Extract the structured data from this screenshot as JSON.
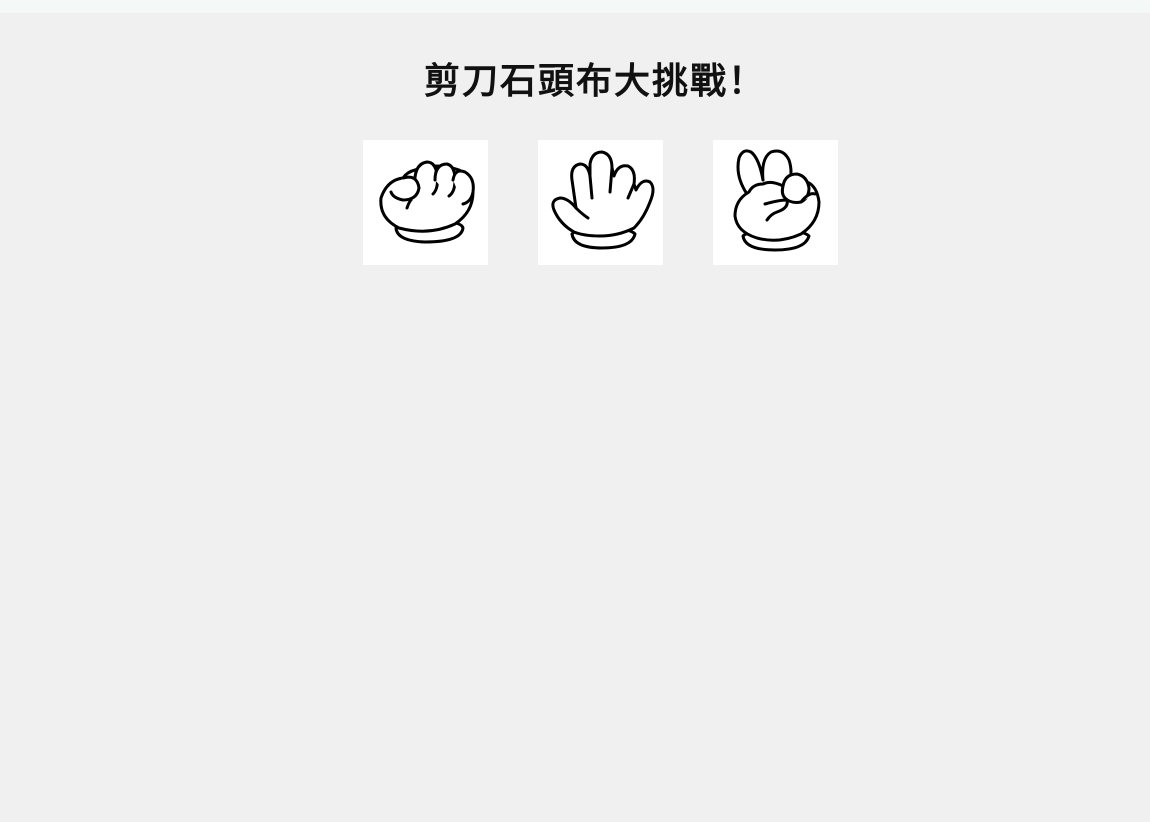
{
  "header": {
    "title": "剪刀石頭布大挑戰！"
  },
  "choices": [
    {
      "name": "rock",
      "icon": "rock-hand-icon"
    },
    {
      "name": "paper",
      "icon": "paper-hand-icon"
    },
    {
      "name": "scissors",
      "icon": "scissors-hand-icon"
    }
  ],
  "colors": {
    "background": "#f0f0f0",
    "card": "#ffffff",
    "outline": "#000000"
  }
}
